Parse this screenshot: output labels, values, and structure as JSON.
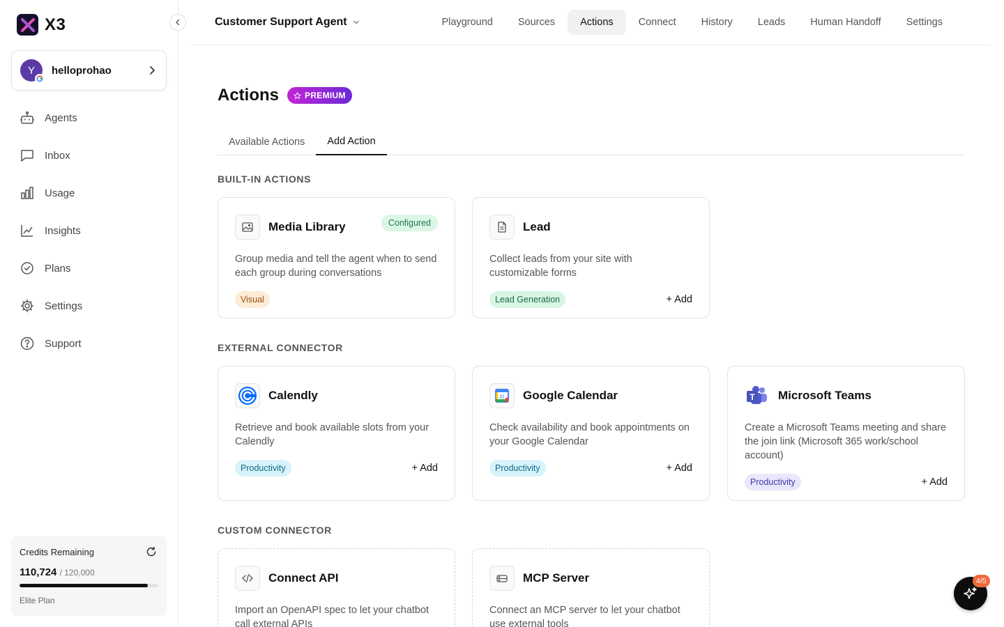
{
  "app": {
    "name": "X3"
  },
  "account": {
    "avatar_letter": "Y",
    "name": "helloprohao"
  },
  "nav": [
    {
      "label": "Agents",
      "icon": "robot-icon"
    },
    {
      "label": "Inbox",
      "icon": "message-icon"
    },
    {
      "label": "Usage",
      "icon": "bar-chart-icon"
    },
    {
      "label": "Insights",
      "icon": "line-chart-icon"
    },
    {
      "label": "Plans",
      "icon": "check-circle-icon"
    },
    {
      "label": "Settings",
      "icon": "gear-icon"
    },
    {
      "label": "Support",
      "icon": "help-circle-icon"
    }
  ],
  "credits": {
    "title": "Credits Remaining",
    "remaining": "110,724",
    "total": "/ 120,000",
    "fraction": 0.9227,
    "plan": "Elite Plan"
  },
  "topbar": {
    "agent": "Customer Support Agent",
    "tabs": [
      "Playground",
      "Sources",
      "Actions",
      "Connect",
      "History",
      "Leads",
      "Human Handoff",
      "Settings"
    ],
    "active_tab": "Actions"
  },
  "page": {
    "title": "Actions",
    "badge": "PREMIUM",
    "subtabs": [
      "Available Actions",
      "Add Action"
    ],
    "active_subtab": "Add Action"
  },
  "sections": {
    "builtin": "BUILT-IN ACTIONS",
    "external": "EXTERNAL CONNECTOR",
    "custom": "CUSTOM CONNECTOR"
  },
  "cards": {
    "media": {
      "title": "Media Library",
      "status": "Configured",
      "desc": "Group media and tell the agent when to send each group during conversations",
      "tag": "Visual"
    },
    "lead": {
      "title": "Lead",
      "desc": "Collect leads from your site with customizable forms",
      "tag": "Lead Generation",
      "action": "+ Add"
    },
    "calendly": {
      "title": "Calendly",
      "desc": "Retrieve and book available slots from your Calendly",
      "tag": "Productivity",
      "action": "+ Add"
    },
    "gcal": {
      "title": "Google Calendar",
      "icon_text": "31",
      "desc": "Check availability and book appointments on your Google Calendar",
      "tag": "Productivity",
      "action": "+ Add"
    },
    "teams": {
      "title": "Microsoft Teams",
      "icon_text": "T",
      "desc": "Create a Microsoft Teams meeting and share the join link (Microsoft 365 work/school account)",
      "tag": "Productivity",
      "action": "+ Add"
    },
    "api": {
      "title": "Connect API",
      "desc": "Import an OpenAPI spec to let your chatbot call external APIs"
    },
    "mcp": {
      "title": "MCP Server",
      "desc": "Connect an MCP server to let your chatbot use external tools"
    }
  },
  "fab": {
    "badge": "4/5"
  },
  "colors": {
    "accent": "#111111",
    "premium_from": "#c026d3",
    "premium_to": "#6d28d9",
    "badge": "#f06a3c"
  }
}
